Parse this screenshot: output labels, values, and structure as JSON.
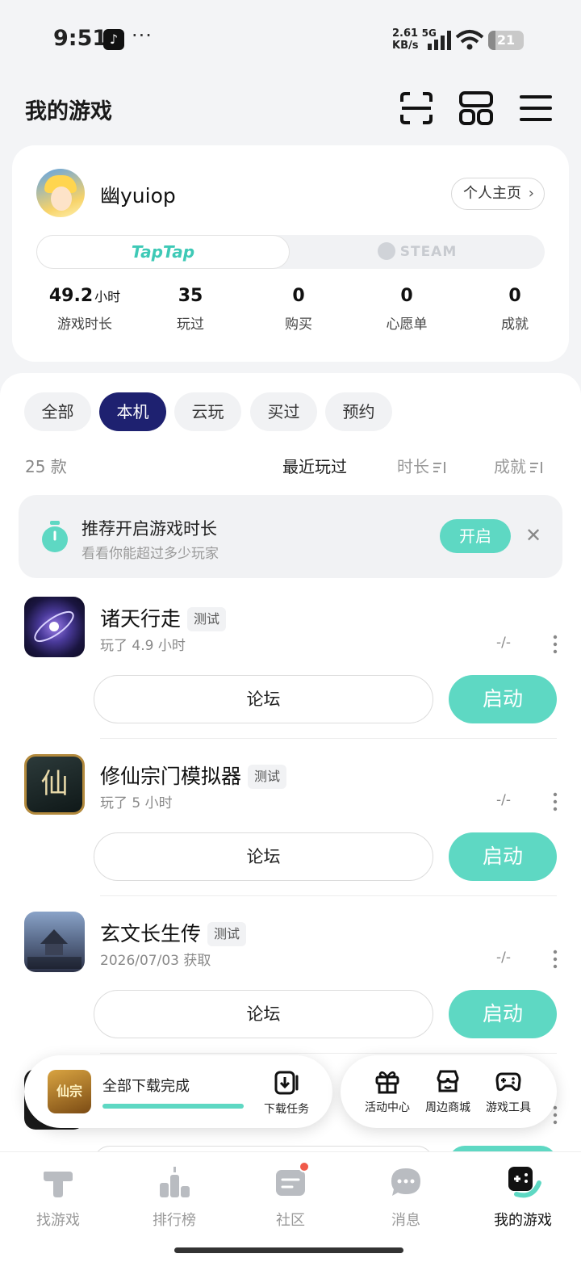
{
  "status_bar": {
    "time": "9:51",
    "speed_value": "2.61",
    "speed_unit": "KB/s",
    "network": "5G",
    "battery": "21",
    "battery_level_pct": 21
  },
  "header": {
    "title": "我的游戏",
    "icons": [
      "scan-icon",
      "grid-icon",
      "menu-icon"
    ]
  },
  "profile": {
    "username": "幽yuiop",
    "homepage_label": "个人主页",
    "platforms": [
      "TapTap",
      "STEAM"
    ],
    "stats": [
      {
        "value": "49.2",
        "unit": "小时",
        "label": "游戏时长"
      },
      {
        "value": "35",
        "unit": "",
        "label": "玩过"
      },
      {
        "value": "0",
        "unit": "",
        "label": "购买"
      },
      {
        "value": "0",
        "unit": "",
        "label": "心愿单"
      },
      {
        "value": "0",
        "unit": "",
        "label": "成就"
      }
    ]
  },
  "filters": {
    "tabs": [
      "全部",
      "本机",
      "云玩",
      "买过",
      "预约"
    ],
    "active": "本机"
  },
  "sort": {
    "count": "25 款",
    "options": [
      "最近玩过",
      "时长",
      "成就"
    ]
  },
  "banner": {
    "title": "推荐开启游戏时长",
    "subtitle": "看看你能超过多少玩家",
    "button": "开启"
  },
  "games": [
    {
      "name": "诸天行走",
      "tag": "测试",
      "meta": "玩了 4.9 小时",
      "rating": "-/-",
      "forum": "论坛",
      "launch": "启动"
    },
    {
      "name": "修仙宗门模拟器",
      "tag": "测试",
      "meta": "玩了 5 小时",
      "rating": "-/-",
      "forum": "论坛",
      "launch": "启动"
    },
    {
      "name": "玄文长生传",
      "tag": "测试",
      "meta": "2026/07/03 获取",
      "rating": "-/-",
      "forum": "论坛",
      "launch": "启动"
    }
  ],
  "download": {
    "thumb_text": "仙宗",
    "status": "全部下载完成",
    "progress_pct": 100,
    "task_label": "下载任务"
  },
  "tools": [
    {
      "label": "活动中心",
      "icon": "gift-icon"
    },
    {
      "label": "周边商城",
      "icon": "shop-icon"
    },
    {
      "label": "游戏工具",
      "icon": "gamepad-icon"
    }
  ],
  "nav": [
    {
      "label": "找游戏",
      "icon": "taptap-icon"
    },
    {
      "label": "排行榜",
      "icon": "ranking-icon"
    },
    {
      "label": "社区",
      "icon": "community-icon"
    },
    {
      "label": "消息",
      "icon": "message-icon"
    },
    {
      "label": "我的游戏",
      "icon": "my-games-icon"
    }
  ],
  "colors": {
    "accent": "#5ed8c3",
    "active_tab": "#1e2170",
    "badge": "#f05a4a"
  }
}
